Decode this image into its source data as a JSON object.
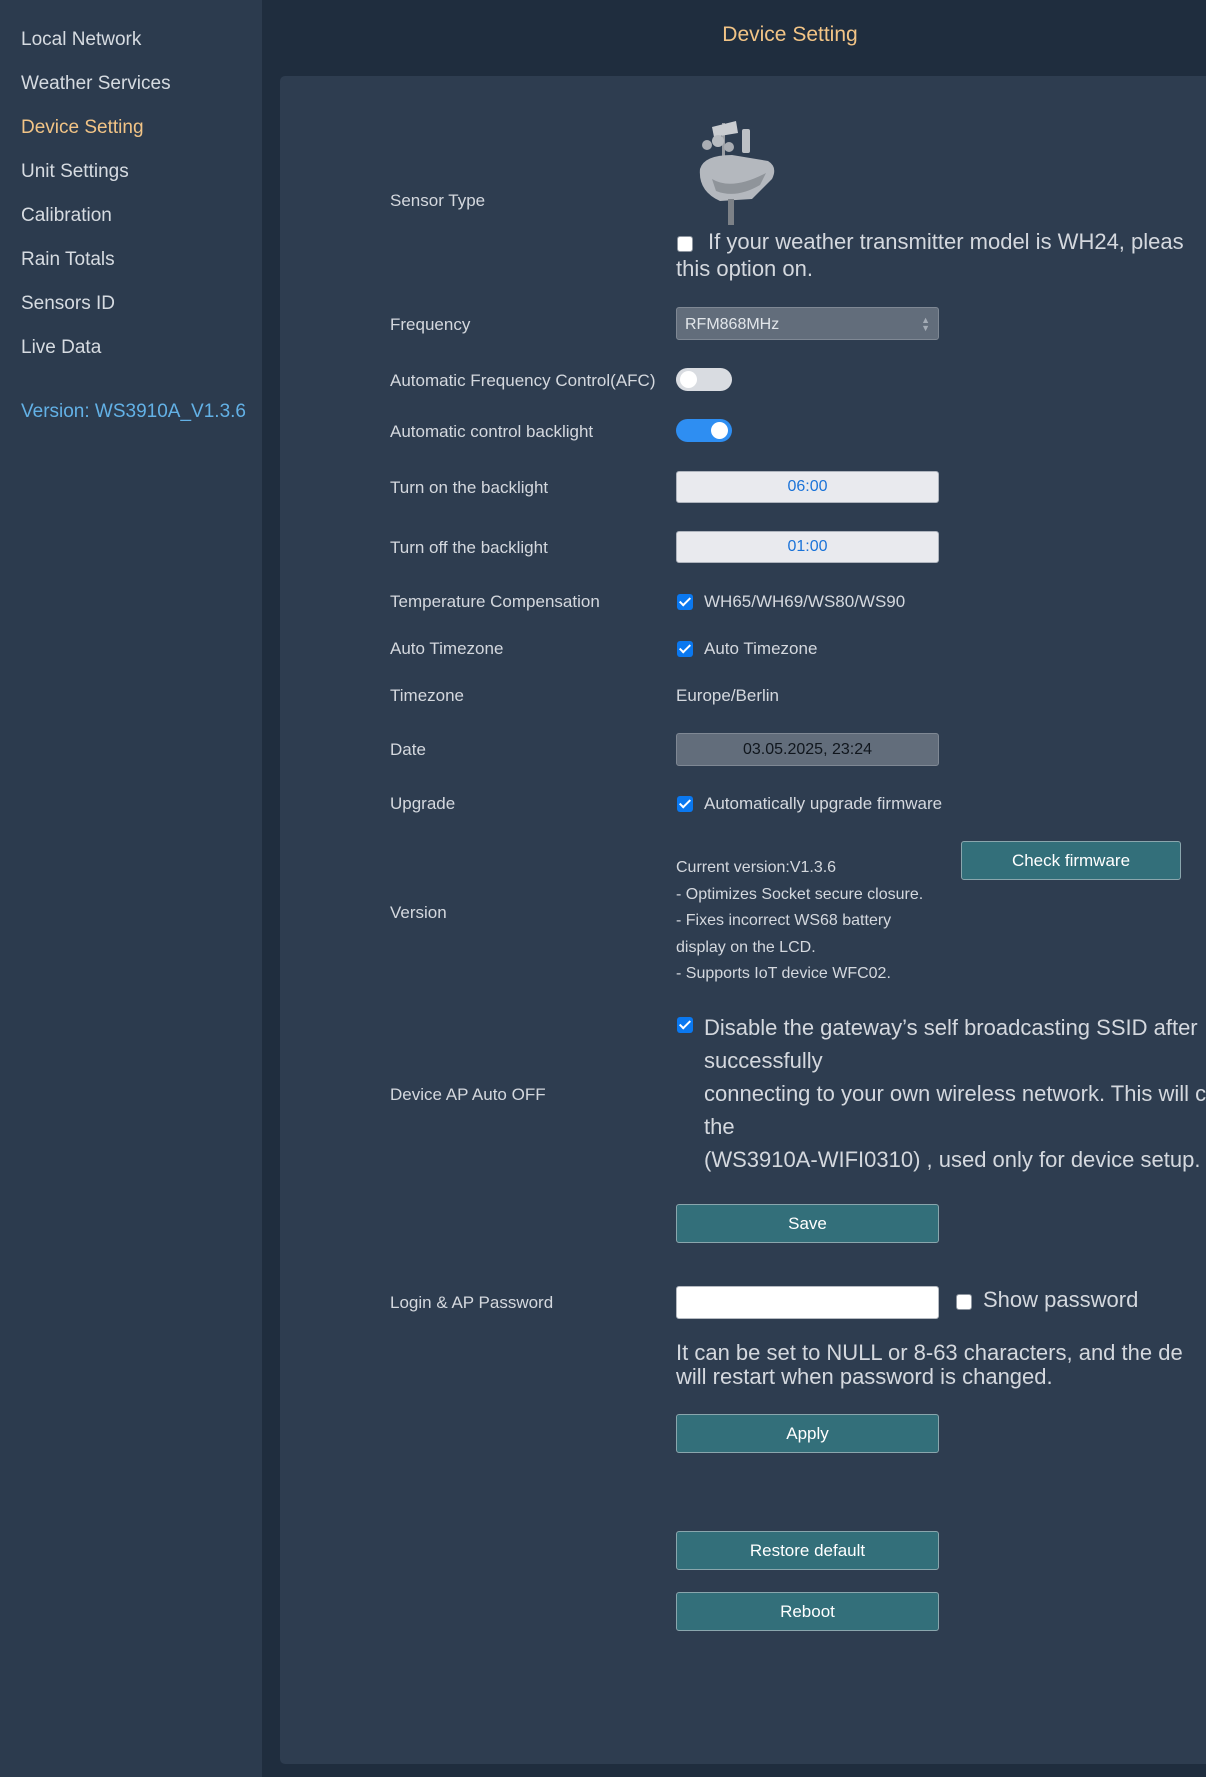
{
  "app": {
    "header_title": "Device Setting"
  },
  "sidebar": {
    "items": [
      {
        "label": "Local Network"
      },
      {
        "label": "Weather Services"
      },
      {
        "label": "Device Setting",
        "active": true
      },
      {
        "label": "Unit Settings"
      },
      {
        "label": "Calibration"
      },
      {
        "label": "Rain Totals"
      },
      {
        "label": "Sensors ID"
      },
      {
        "label": "Live Data"
      }
    ],
    "version": "Version: WS3910A_V1.3.6"
  },
  "settings": {
    "sensor_type": {
      "label": "Sensor Type",
      "icon": "weather-station-sensor-icon",
      "wh24_checked": false,
      "wh24_text_line1": "If your weather transmitter model is WH24, pleas",
      "wh24_text_line2": "this option on."
    },
    "frequency": {
      "label": "Frequency",
      "selected": "RFM868MHz"
    },
    "afc": {
      "label": "Automatic Frequency Control(AFC)",
      "enabled": false
    },
    "auto_backlight": {
      "label": "Automatic control backlight",
      "enabled": true
    },
    "backlight_on": {
      "label": "Turn on the backlight",
      "value": "06:00"
    },
    "backlight_off": {
      "label": "Turn off the backlight",
      "value": "01:00"
    },
    "temp_compensation": {
      "label": "Temperature Compensation",
      "checked": true,
      "option": "WH65/WH69/WS80/WS90"
    },
    "auto_timezone": {
      "label": "Auto Timezone",
      "checked": true,
      "option": "Auto Timezone"
    },
    "timezone": {
      "label": "Timezone",
      "value": "Europe/Berlin"
    },
    "date": {
      "label": "Date",
      "value": "03.05.2025, 23:24"
    },
    "upgrade": {
      "label": "Upgrade",
      "checked": true,
      "option": "Automatically upgrade firmware"
    },
    "version": {
      "label": "Version",
      "notes": [
        "Current version:V1.3.6",
        "- Optimizes Socket secure closure.",
        "- Fixes incorrect WS68 battery",
        "display on the LCD.",
        "- Supports IoT device WFC02."
      ],
      "check_button": "Check firmware"
    },
    "ap_auto_off": {
      "label": "Device AP Auto OFF",
      "checked": true,
      "lines": [
        "Disable the gateway’s self broadcasting SSID after",
        "successfully",
        "connecting to your own wireless network. This will c",
        "the",
        "(WS3910A-WIFI0310) , used only for device setup."
      ]
    },
    "save_button": "Save",
    "password": {
      "label": "Login & AP Password",
      "value": "",
      "show_password_checked": false,
      "show_password_label": "Show password",
      "hint_line1": "It can be set to NULL or 8-63 characters, and the de",
      "hint_line2": "will restart when password is changed.",
      "apply_button": "Apply"
    },
    "restore_button": "Restore default",
    "reboot_button": "Reboot"
  },
  "colors": {
    "background": "#1f2d3e",
    "sidebar": "#2c3b4e",
    "panel": "#2e3d50",
    "accent_active": "#f2c486",
    "version_link": "#63b1e6",
    "button": "#336f7a",
    "toggle_on": "#2e8ef2",
    "checkbox": "#0a78f0"
  }
}
